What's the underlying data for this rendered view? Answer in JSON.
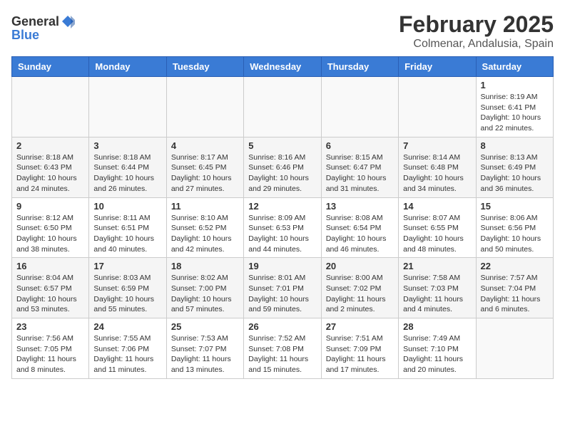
{
  "header": {
    "logo_general": "General",
    "logo_blue": "Blue",
    "month": "February 2025",
    "location": "Colmenar, Andalusia, Spain"
  },
  "weekdays": [
    "Sunday",
    "Monday",
    "Tuesday",
    "Wednesday",
    "Thursday",
    "Friday",
    "Saturday"
  ],
  "weeks": [
    [
      {
        "day": "",
        "info": ""
      },
      {
        "day": "",
        "info": ""
      },
      {
        "day": "",
        "info": ""
      },
      {
        "day": "",
        "info": ""
      },
      {
        "day": "",
        "info": ""
      },
      {
        "day": "",
        "info": ""
      },
      {
        "day": "1",
        "info": "Sunrise: 8:19 AM\nSunset: 6:41 PM\nDaylight: 10 hours\nand 22 minutes."
      }
    ],
    [
      {
        "day": "2",
        "info": "Sunrise: 8:18 AM\nSunset: 6:43 PM\nDaylight: 10 hours\nand 24 minutes."
      },
      {
        "day": "3",
        "info": "Sunrise: 8:18 AM\nSunset: 6:44 PM\nDaylight: 10 hours\nand 26 minutes."
      },
      {
        "day": "4",
        "info": "Sunrise: 8:17 AM\nSunset: 6:45 PM\nDaylight: 10 hours\nand 27 minutes."
      },
      {
        "day": "5",
        "info": "Sunrise: 8:16 AM\nSunset: 6:46 PM\nDaylight: 10 hours\nand 29 minutes."
      },
      {
        "day": "6",
        "info": "Sunrise: 8:15 AM\nSunset: 6:47 PM\nDaylight: 10 hours\nand 31 minutes."
      },
      {
        "day": "7",
        "info": "Sunrise: 8:14 AM\nSunset: 6:48 PM\nDaylight: 10 hours\nand 34 minutes."
      },
      {
        "day": "8",
        "info": "Sunrise: 8:13 AM\nSunset: 6:49 PM\nDaylight: 10 hours\nand 36 minutes."
      }
    ],
    [
      {
        "day": "9",
        "info": "Sunrise: 8:12 AM\nSunset: 6:50 PM\nDaylight: 10 hours\nand 38 minutes."
      },
      {
        "day": "10",
        "info": "Sunrise: 8:11 AM\nSunset: 6:51 PM\nDaylight: 10 hours\nand 40 minutes."
      },
      {
        "day": "11",
        "info": "Sunrise: 8:10 AM\nSunset: 6:52 PM\nDaylight: 10 hours\nand 42 minutes."
      },
      {
        "day": "12",
        "info": "Sunrise: 8:09 AM\nSunset: 6:53 PM\nDaylight: 10 hours\nand 44 minutes."
      },
      {
        "day": "13",
        "info": "Sunrise: 8:08 AM\nSunset: 6:54 PM\nDaylight: 10 hours\nand 46 minutes."
      },
      {
        "day": "14",
        "info": "Sunrise: 8:07 AM\nSunset: 6:55 PM\nDaylight: 10 hours\nand 48 minutes."
      },
      {
        "day": "15",
        "info": "Sunrise: 8:06 AM\nSunset: 6:56 PM\nDaylight: 10 hours\nand 50 minutes."
      }
    ],
    [
      {
        "day": "16",
        "info": "Sunrise: 8:04 AM\nSunset: 6:57 PM\nDaylight: 10 hours\nand 53 minutes."
      },
      {
        "day": "17",
        "info": "Sunrise: 8:03 AM\nSunset: 6:59 PM\nDaylight: 10 hours\nand 55 minutes."
      },
      {
        "day": "18",
        "info": "Sunrise: 8:02 AM\nSunset: 7:00 PM\nDaylight: 10 hours\nand 57 minutes."
      },
      {
        "day": "19",
        "info": "Sunrise: 8:01 AM\nSunset: 7:01 PM\nDaylight: 10 hours\nand 59 minutes."
      },
      {
        "day": "20",
        "info": "Sunrise: 8:00 AM\nSunset: 7:02 PM\nDaylight: 11 hours\nand 2 minutes."
      },
      {
        "day": "21",
        "info": "Sunrise: 7:58 AM\nSunset: 7:03 PM\nDaylight: 11 hours\nand 4 minutes."
      },
      {
        "day": "22",
        "info": "Sunrise: 7:57 AM\nSunset: 7:04 PM\nDaylight: 11 hours\nand 6 minutes."
      }
    ],
    [
      {
        "day": "23",
        "info": "Sunrise: 7:56 AM\nSunset: 7:05 PM\nDaylight: 11 hours\nand 8 minutes."
      },
      {
        "day": "24",
        "info": "Sunrise: 7:55 AM\nSunset: 7:06 PM\nDaylight: 11 hours\nand 11 minutes."
      },
      {
        "day": "25",
        "info": "Sunrise: 7:53 AM\nSunset: 7:07 PM\nDaylight: 11 hours\nand 13 minutes."
      },
      {
        "day": "26",
        "info": "Sunrise: 7:52 AM\nSunset: 7:08 PM\nDaylight: 11 hours\nand 15 minutes."
      },
      {
        "day": "27",
        "info": "Sunrise: 7:51 AM\nSunset: 7:09 PM\nDaylight: 11 hours\nand 17 minutes."
      },
      {
        "day": "28",
        "info": "Sunrise: 7:49 AM\nSunset: 7:10 PM\nDaylight: 11 hours\nand 20 minutes."
      },
      {
        "day": "",
        "info": ""
      }
    ]
  ]
}
